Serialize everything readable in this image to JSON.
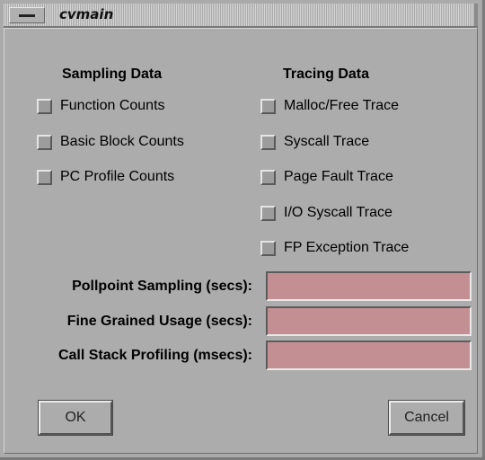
{
  "window": {
    "title": "cvmain",
    "menu_icon": "window-menu-bar-icon"
  },
  "sampling": {
    "title": "Sampling Data",
    "options": [
      {
        "label": "Function Counts",
        "checked": false
      },
      {
        "label": "Basic Block Counts",
        "checked": false
      },
      {
        "label": "PC Profile Counts",
        "checked": false
      }
    ]
  },
  "tracing": {
    "title": "Tracing Data",
    "options": [
      {
        "label": "Malloc/Free Trace",
        "checked": false
      },
      {
        "label": "Syscall Trace",
        "checked": false
      },
      {
        "label": "Page Fault Trace",
        "checked": false
      },
      {
        "label": "I/O Syscall Trace",
        "checked": false
      },
      {
        "label": "FP Exception Trace",
        "checked": false
      }
    ]
  },
  "fields": [
    {
      "label": "Pollpoint Sampling (secs):",
      "value": ""
    },
    {
      "label": "Fine Grained Usage (secs):",
      "value": ""
    },
    {
      "label": "Call Stack Profiling (msecs):",
      "value": ""
    }
  ],
  "buttons": {
    "ok": "OK",
    "cancel": "Cancel"
  },
  "colors": {
    "background": "#acacac",
    "field_fill": "#c48f92"
  }
}
